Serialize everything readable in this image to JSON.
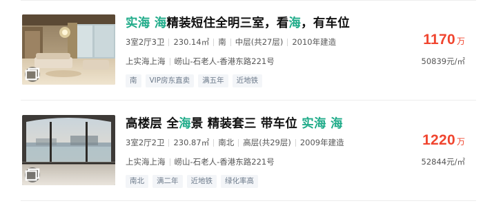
{
  "listings": [
    {
      "title": {
        "parts": [
          {
            "text": "实海 海",
            "highlight": true
          },
          {
            "text": "精装短住全明三室，看",
            "highlight": false
          },
          {
            "text": "海",
            "highlight": true
          },
          {
            "text": "，有车位",
            "highlight": false
          }
        ]
      },
      "specs": [
        "3室2厅3卫",
        "230.14㎡",
        "南",
        "中层(共27层)",
        "2010年建造"
      ],
      "community": "上实海上海",
      "address": "崂山-石老人-香港东路221号",
      "tags": [
        "南",
        "VIP房东直卖",
        "满五年",
        "近地铁"
      ],
      "price": {
        "value": "1170",
        "unit": "万"
      },
      "unit_price": "50839元/㎡"
    },
    {
      "title": {
        "parts": [
          {
            "text": "高楼层 全",
            "highlight": false
          },
          {
            "text": "海",
            "highlight": true
          },
          {
            "text": "景 精装套三 带车位 ",
            "highlight": false
          },
          {
            "text": "实海 海",
            "highlight": true
          }
        ]
      },
      "specs": [
        "3室2厅2卫",
        "230.87㎡",
        "南北",
        "高层(共29层)",
        "2009年建造"
      ],
      "community": "上实海上海",
      "address": "崂山-石老人-香港东路221号",
      "tags": [
        "南北",
        "满二年",
        "近地铁",
        "绿化率高"
      ],
      "price": {
        "value": "1220",
        "unit": "万"
      },
      "unit_price": "52844元/㎡"
    }
  ],
  "colors": {
    "accent_green": "#1fab89",
    "price_red": "#f0452f",
    "tag_bg": "#f3f5f8",
    "tag_text": "#6c7a8a"
  },
  "icons": {
    "photo_badge": "gallery-icon"
  }
}
